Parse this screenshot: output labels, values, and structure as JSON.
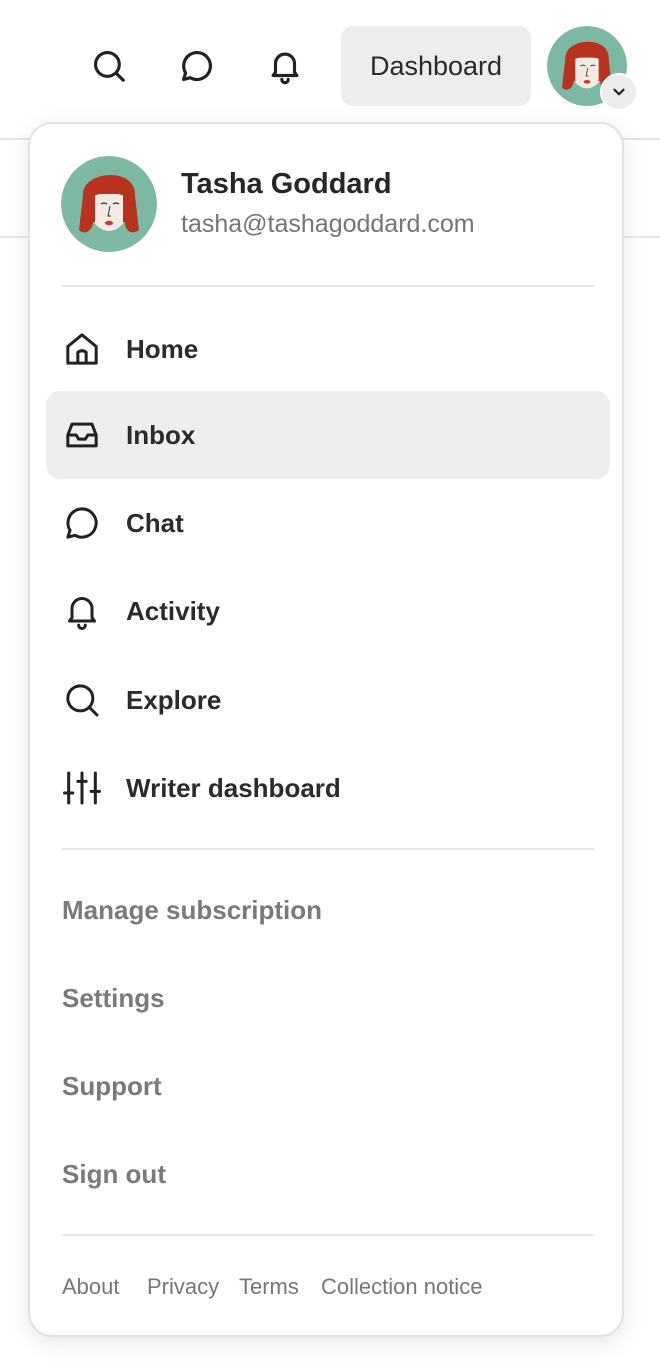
{
  "header": {
    "dashboard_label": "Dashboard",
    "icons": [
      "search-icon",
      "chat-icon",
      "bell-icon",
      "chevron-down-icon"
    ]
  },
  "profile": {
    "name": "Tasha Goddard",
    "email": "tasha@tashagoddard.com"
  },
  "nav": {
    "items": [
      {
        "label": "Home",
        "icon": "home-icon"
      },
      {
        "label": "Inbox",
        "icon": "inbox-icon",
        "active": true
      },
      {
        "label": "Chat",
        "icon": "chat-icon"
      },
      {
        "label": "Activity",
        "icon": "bell-icon"
      },
      {
        "label": "Explore",
        "icon": "search-icon"
      },
      {
        "label": "Writer dashboard",
        "icon": "sliders-icon"
      }
    ]
  },
  "secondary": {
    "items": [
      "Manage subscription",
      "Settings",
      "Support",
      "Sign out"
    ]
  },
  "footer": {
    "links": [
      "About",
      "Privacy",
      "Terms",
      "Collection notice"
    ]
  },
  "colors": {
    "avatar_bg": "#7db8a2",
    "hair": "#b8321f",
    "active_item_bg": "#eeeeee",
    "secondary_text": "#7a7a7a"
  }
}
